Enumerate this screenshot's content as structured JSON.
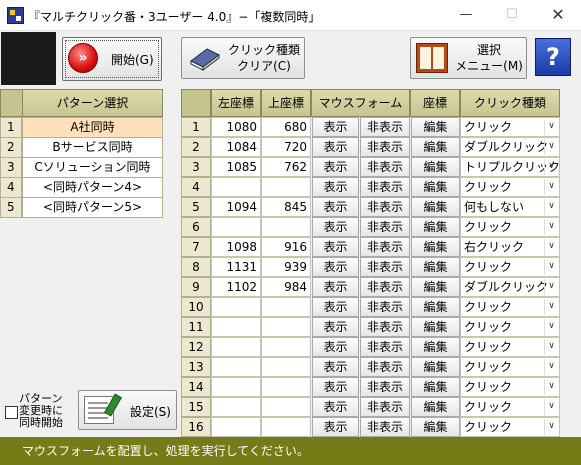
{
  "window": {
    "title": "『マルチクリック番・3ユーザー 4.0』−「複数同時」",
    "min_glyph": "—",
    "max_glyph": "☐",
    "close_glyph": "✕"
  },
  "toolbar": {
    "start_label": "開始(G)",
    "start_icon_glyph": "»",
    "clear_label_line1": "クリック種類",
    "clear_label_line2": "クリア(C)",
    "menu_label_line1": "選択",
    "menu_label_line2": "メニュー(M)",
    "help_glyph": "?"
  },
  "pattern": {
    "header": "パターン選択",
    "items": [
      {
        "num": "1",
        "label": "A社同時"
      },
      {
        "num": "2",
        "label": "Bサービス同時"
      },
      {
        "num": "3",
        "label": "Cソリューション同時"
      },
      {
        "num": "4",
        "label": "<同時パターン4>"
      },
      {
        "num": "5",
        "label": "<同時パターン5>"
      }
    ],
    "selected_index": 0,
    "checkbox_label": "パターン変更時に同時開始",
    "settings_label": "設定(S)"
  },
  "grid": {
    "headers": {
      "left": "左座標",
      "top": "上座標",
      "form": "マウスフォーム",
      "coord": "座標",
      "click_type": "クリック種類"
    },
    "show_label": "表示",
    "hide_label": "非表示",
    "edit_label": "編集",
    "rows": [
      {
        "num": "1",
        "x": "1080",
        "y": "680",
        "click": "クリック"
      },
      {
        "num": "2",
        "x": "1084",
        "y": "720",
        "click": "ダブルクリック"
      },
      {
        "num": "3",
        "x": "1085",
        "y": "762",
        "click": "トリプルクリック"
      },
      {
        "num": "4",
        "x": "",
        "y": "",
        "click": "クリック"
      },
      {
        "num": "5",
        "x": "1094",
        "y": "845",
        "click": "何もしない"
      },
      {
        "num": "6",
        "x": "",
        "y": "",
        "click": "クリック"
      },
      {
        "num": "7",
        "x": "1098",
        "y": "916",
        "click": "右クリック"
      },
      {
        "num": "8",
        "x": "1131",
        "y": "939",
        "click": "クリック"
      },
      {
        "num": "9",
        "x": "1102",
        "y": "984",
        "click": "ダブルクリック"
      },
      {
        "num": "10",
        "x": "",
        "y": "",
        "click": "クリック"
      },
      {
        "num": "11",
        "x": "",
        "y": "",
        "click": "クリック"
      },
      {
        "num": "12",
        "x": "",
        "y": "",
        "click": "クリック"
      },
      {
        "num": "13",
        "x": "",
        "y": "",
        "click": "クリック"
      },
      {
        "num": "14",
        "x": "",
        "y": "",
        "click": "クリック"
      },
      {
        "num": "15",
        "x": "",
        "y": "",
        "click": "クリック"
      },
      {
        "num": "16",
        "x": "",
        "y": "",
        "click": "クリック"
      }
    ]
  },
  "status": {
    "text": "マウスフォームを配置し、処理を実行してください。",
    "bar_color": "#747b17"
  }
}
